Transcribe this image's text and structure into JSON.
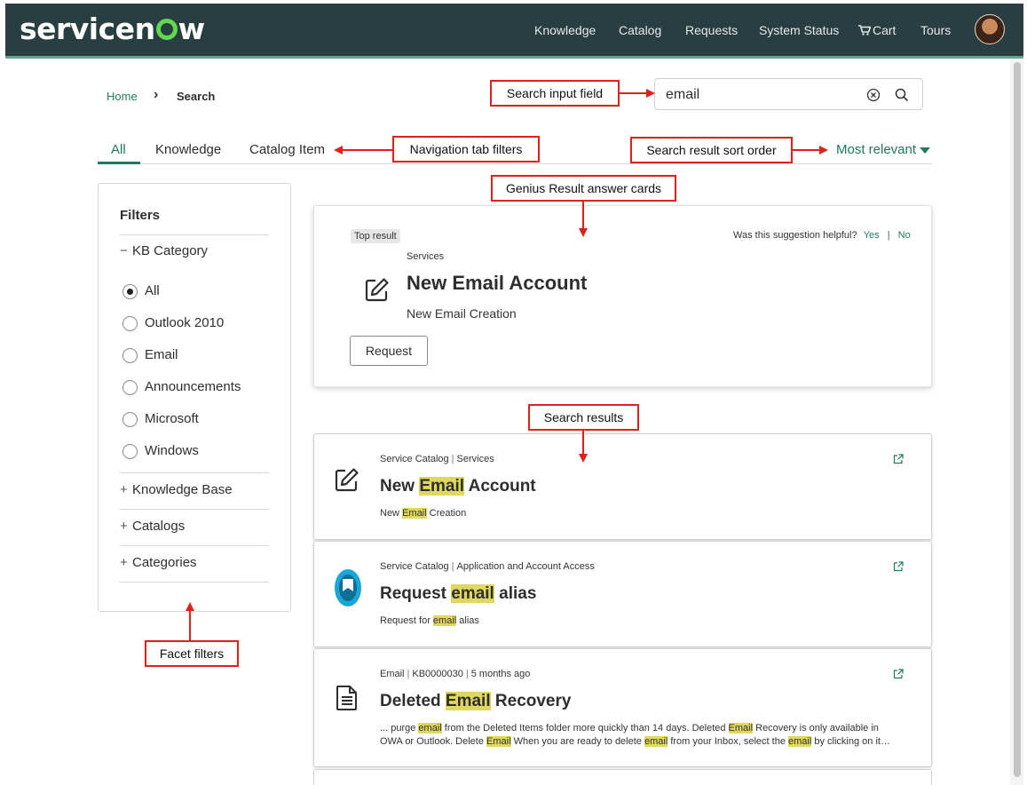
{
  "header": {
    "logo_text_before": "servicen",
    "logo_text_after": "w",
    "nav": [
      "Knowledge",
      "Catalog",
      "Requests",
      "System Status",
      "Cart",
      "Tours"
    ],
    "colors": {
      "bar": "#293e40",
      "accent": "#62d84e",
      "link": "#1f7a60"
    }
  },
  "breadcrumb": {
    "home": "Home",
    "separator": "›",
    "current": "Search"
  },
  "search": {
    "value": "email"
  },
  "tabs": {
    "all": "All",
    "knowledge": "Knowledge",
    "catalog_item": "Catalog Item"
  },
  "sort": {
    "label": "Most relevant"
  },
  "filters": {
    "title": "Filters",
    "kb_category": "KB Category",
    "options": [
      "All",
      "Outlook 2010",
      "Email",
      "Announcements",
      "Microsoft",
      "Windows"
    ],
    "selected": "All",
    "knowledge_base": "Knowledge Base",
    "catalogs": "Catalogs",
    "categories": "Categories",
    "minus": "−",
    "plus": "+"
  },
  "genius": {
    "badge": "Top result",
    "helpful_q": "Was this suggestion helpful?",
    "yes": "Yes",
    "sep": "|",
    "no": "No",
    "category": "Services",
    "title": "New Email Account",
    "subtitle": "New Email Creation",
    "button": "Request"
  },
  "results": [
    {
      "meta": [
        "Service Catalog",
        "Services"
      ],
      "title_pre": "New ",
      "title_hl": "Email",
      "title_post": " Account",
      "snip_pre": "New ",
      "snip_hl": "Email",
      "snip_post": " Creation",
      "icon": "edit-icon"
    },
    {
      "meta": [
        "Service Catalog",
        "Application and Account Access"
      ],
      "title_pre": "Request ",
      "title_hl": "email",
      "title_post": " alias",
      "snip_pre": "Request for ",
      "snip_hl": "email",
      "snip_post": " alias",
      "icon": "mail-badge-icon"
    },
    {
      "meta": [
        "Email",
        "KB0000030",
        "5 months ago"
      ],
      "title_pre": "Deleted ",
      "title_hl": "Email",
      "title_post": " Recovery",
      "snippet": {
        "a": "... purge ",
        "b": "email",
        "c": " from the Deleted Items folder more quickly than 14 days. Deleted ",
        "d": "Email",
        "e": " Recovery is only available in",
        "f": "OWA or Outlook. Delete ",
        "g": "Email",
        "h": " When you are ready to delete ",
        "i": "email",
        "j": " from your Inbox, select the ",
        "k": "email",
        "l": " by clicking on it…"
      },
      "icon": "document-icon"
    }
  ],
  "annotations": {
    "search_input": "Search input field",
    "nav_tabs": "Navigation tab filters",
    "sort_order": "Search result sort order",
    "genius": "Genius Result answer cards",
    "results": "Search results",
    "facets": "Facet filters"
  }
}
